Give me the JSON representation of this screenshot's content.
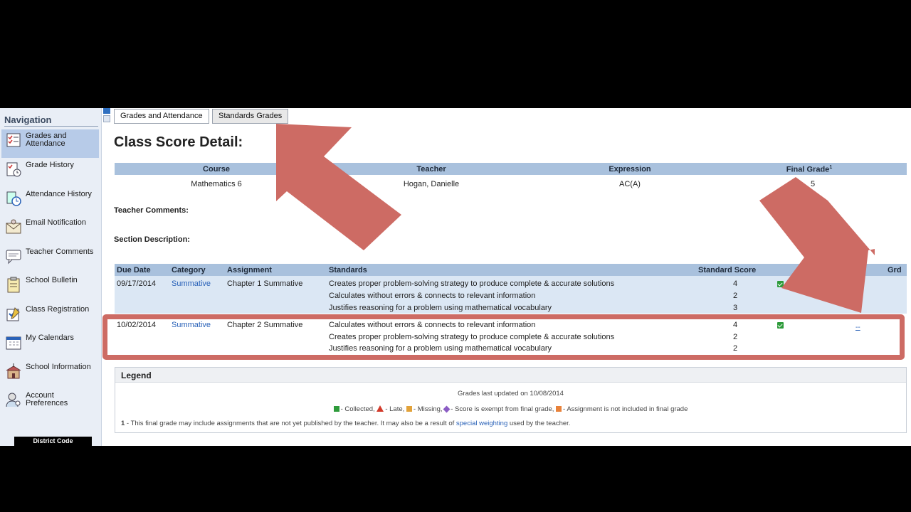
{
  "nav": {
    "title": "Navigation",
    "items": [
      {
        "label": "Grades and Attendance",
        "icon": "grades-attendance-icon",
        "active": true
      },
      {
        "label": "Grade History",
        "icon": "grade-history-icon",
        "active": false
      },
      {
        "label": "Attendance History",
        "icon": "attendance-history-icon",
        "active": false
      },
      {
        "label": "Email Notification",
        "icon": "email-icon",
        "active": false
      },
      {
        "label": "Teacher Comments",
        "icon": "comments-icon",
        "active": false
      },
      {
        "label": "School Bulletin",
        "icon": "bulletin-icon",
        "active": false
      },
      {
        "label": "Class Registration",
        "icon": "registration-icon",
        "active": false
      },
      {
        "label": "My Calendars",
        "icon": "calendar-icon",
        "active": false
      },
      {
        "label": "School Information",
        "icon": "school-icon",
        "active": false
      },
      {
        "label": "Account Preferences",
        "icon": "preferences-icon",
        "active": false
      }
    ],
    "district_code": "District Code"
  },
  "tabs": [
    "Grades and Attendance",
    "Standards Grades"
  ],
  "page_title": "Class Score Detail:",
  "class_table": {
    "headers": {
      "course": "Course",
      "teacher": "Teacher",
      "expression": "Expression",
      "final_grade": "Final Grade",
      "final_grade_note": "1"
    },
    "row": {
      "course": "Mathematics 6",
      "teacher": "Hogan, Danielle",
      "expression": "AC(A)",
      "final_grade": "5"
    }
  },
  "teacher_comments_label": "Teacher Comments:",
  "section_description_label": "Section Description:",
  "assignments": {
    "headers": {
      "due_date": "Due Date",
      "category": "Category",
      "assignment": "Assignment",
      "standards": "Standards",
      "standard_score": "Standard Score",
      "grd": "Grd"
    },
    "rows": [
      {
        "due_date": "09/17/2014",
        "category": "Summative",
        "assignment": "Chapter 1 Summative",
        "standards": [
          {
            "text": "Creates proper problem-solving strategy to produce complete & accurate solutions",
            "score": "4"
          },
          {
            "text": "Calculates without errors & connects to relevant information",
            "score": "2"
          },
          {
            "text": "Justifies reasoning for a problem using mathematical vocabulary",
            "score": "3"
          }
        ],
        "collected": true,
        "grd": ""
      },
      {
        "due_date": "10/02/2014",
        "category": "Summative",
        "assignment": "Chapter 2 Summative",
        "standards": [
          {
            "text": "Calculates without errors & connects to relevant information",
            "score": "4"
          },
          {
            "text": "Creates proper problem-solving strategy to produce complete & accurate solutions",
            "score": "2"
          },
          {
            "text": "Justifies reasoning for a problem using mathematical vocabulary",
            "score": "2"
          }
        ],
        "collected": true,
        "grd": "--"
      }
    ]
  },
  "legend": {
    "title": "Legend",
    "updated": "Grades last updated on 10/08/2014",
    "collected": "- Collected,",
    "late": "- Late,",
    "missing": "- Missing,",
    "exempt": "- Score is exempt from final grade,",
    "not_included": "- Assignment is not included in final grade",
    "note_number": "1",
    "note_text": " - This final grade may include assignments that are not yet published by the teacher. It may also be a result of ",
    "note_link": "special weighting",
    "note_end": " used by the teacher."
  },
  "colors": {
    "header_blue": "#a9c1dd",
    "row_blue": "#dbe7f4",
    "link_blue": "#2a62b8",
    "annotation_red": "#cd6b64",
    "check_green": "#2e9b3b"
  }
}
